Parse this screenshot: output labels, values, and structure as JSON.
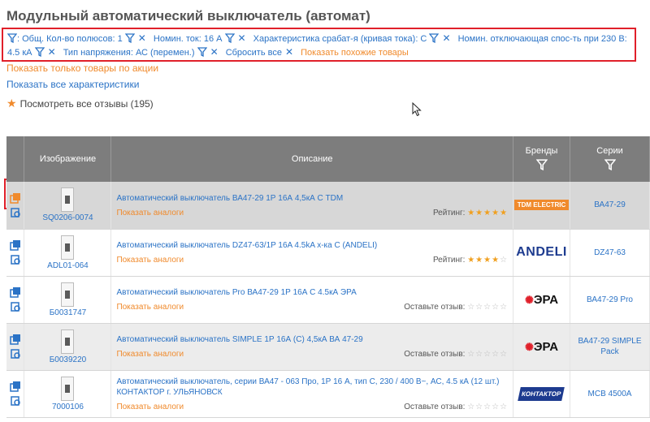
{
  "page": {
    "title": "Модульный автоматический выключатель (автомат)"
  },
  "filters": {
    "lead": ":",
    "items": [
      "Общ. Кол-во полюсов: 1",
      "Номин. ток: 16 А",
      "Характеристика срабат-я (кривая тока): С",
      "Номин. отключающая спос-ть при 230 В: 4.5 кА",
      "Тип напряжения: АС (перемен.)"
    ],
    "reset_label": "Сбросить все",
    "similar_label": "Показать похожие товары",
    "close_glyph": "✕"
  },
  "links": {
    "promo": "Показать только товары по акции",
    "all_specs": "Показать все характеристики",
    "reviews": "Посмотреть все отзывы (195)"
  },
  "table": {
    "headers": {
      "image": "Изображение",
      "description": "Описание",
      "brands": "Бренды",
      "series": "Серии"
    },
    "rows": [
      {
        "sku": "SQ0206-0074",
        "title": "Автоматический выключатель ВА47-29 1Р 16А 4,5кА С TDM",
        "analogs": "Показать аналоги",
        "rating_label": "Рейтинг:",
        "stars": 5,
        "brand": "TDM ELECTRIC",
        "series": "ВА47-29"
      },
      {
        "sku": "ADL01-064",
        "title": "Автоматический выключатель DZ47-63/1P 16A 4.5kA х-ка С (ANDELI)",
        "analogs": "Показать аналоги",
        "rating_label": "Рейтинг:",
        "stars": 4,
        "brand": "ANDELI",
        "series": "DZ47-63"
      },
      {
        "sku": "Б0031747",
        "title": "Автоматический выключатель Pro ВА47-29 1Р 16А С 4.5кА ЭРА",
        "analogs": "Показать аналоги",
        "rating_label": "Оставьте отзыв:",
        "stars": 0,
        "brand": "ЭРА",
        "series": "ВА47-29 Pro"
      },
      {
        "sku": "Б0039220",
        "title": "Автоматический выключатель SIMPLE 1Р 16А (С) 4,5кА ВА 47-29",
        "analogs": "Показать аналоги",
        "rating_label": "Оставьте отзыв:",
        "stars": 0,
        "brand": "ЭРА",
        "series": "ВА47-29 SIMPLE Pack"
      },
      {
        "sku": "7000106",
        "title": "Автоматический выключатель, серии ВА47 - 063 Про, 1Р 16 А, тип С, 230 / 400 В~, АС, 4.5 кА (12 шт.) КОНТАКТОР г. УЛЬЯНОВСК",
        "analogs": "Показать аналоги",
        "rating_label": "Оставьте отзыв:",
        "stars": 0,
        "brand": "КОНТАКТОР",
        "series": "MCB 4500A"
      }
    ]
  },
  "colors": {
    "accent_blue": "#2b73c6",
    "accent_orange": "#f08a2c",
    "highlight_red": "#e0202a",
    "header_gray": "#7d7d7d"
  }
}
